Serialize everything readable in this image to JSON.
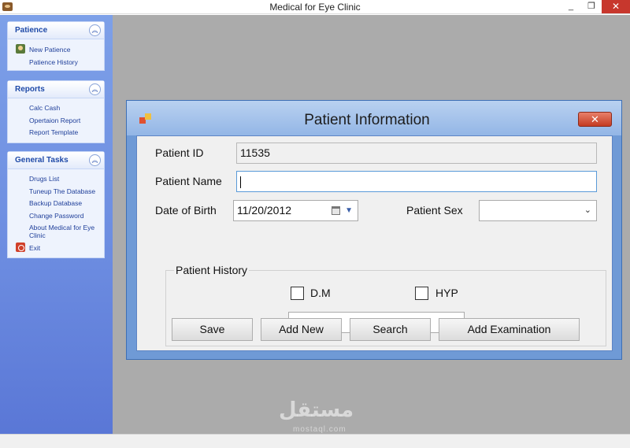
{
  "window": {
    "title": "Medical for Eye Clinic",
    "minimize": "_",
    "maximize": "❐",
    "close": "✕"
  },
  "sidebar": {
    "collapse_glyph": "︽",
    "groups": [
      {
        "title": "Patience",
        "items": [
          "New Patience",
          "Patience History"
        ]
      },
      {
        "title": "Reports",
        "items": [
          "Calc Cash",
          "Opertaion Report",
          "Report Template"
        ]
      },
      {
        "title": "General Tasks",
        "items": [
          "Drugs List",
          "Tuneup The Database",
          "Backup Database",
          "Change Password",
          "About Medical for Eye",
          "Clinic",
          "Exit"
        ]
      }
    ]
  },
  "dialog": {
    "title": "Patient Information",
    "close": "✕",
    "fields": {
      "patient_id_label": "Patient ID",
      "patient_id_value": "11535",
      "patient_name_label": "Patient Name",
      "patient_name_value": "",
      "dob_label": "Date of Birth",
      "dob_value": "11/20/2012",
      "sex_label": "Patient Sex",
      "sex_value": ""
    },
    "history": {
      "legend": "Patient History",
      "dm_label": "D.M",
      "dm_checked": false,
      "hyp_label": "HYP",
      "hyp_checked": false,
      "notes_value": ""
    },
    "buttons": {
      "save": "Save",
      "add_new": "Add New",
      "search": "Search",
      "add_examination": "Add Examination"
    }
  },
  "watermark": {
    "text": "مستقل",
    "sub": "mostaql.com"
  }
}
